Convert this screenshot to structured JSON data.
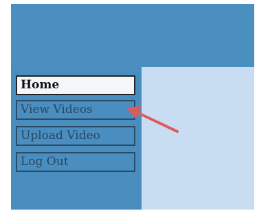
{
  "nav": {
    "items": [
      {
        "label": "Home",
        "active": true
      },
      {
        "label": "View Videos",
        "active": false
      },
      {
        "label": "Upload Video",
        "active": false
      },
      {
        "label": "Log Out",
        "active": false
      }
    ]
  },
  "colors": {
    "frame": "#4a8ec0",
    "content": "#c8dcf2",
    "button_border": "#2a4c68",
    "active_button": "#f4f6fa",
    "arrow": "#e05a5a"
  },
  "annotation": {
    "icon": "pointer-arrow-icon"
  }
}
